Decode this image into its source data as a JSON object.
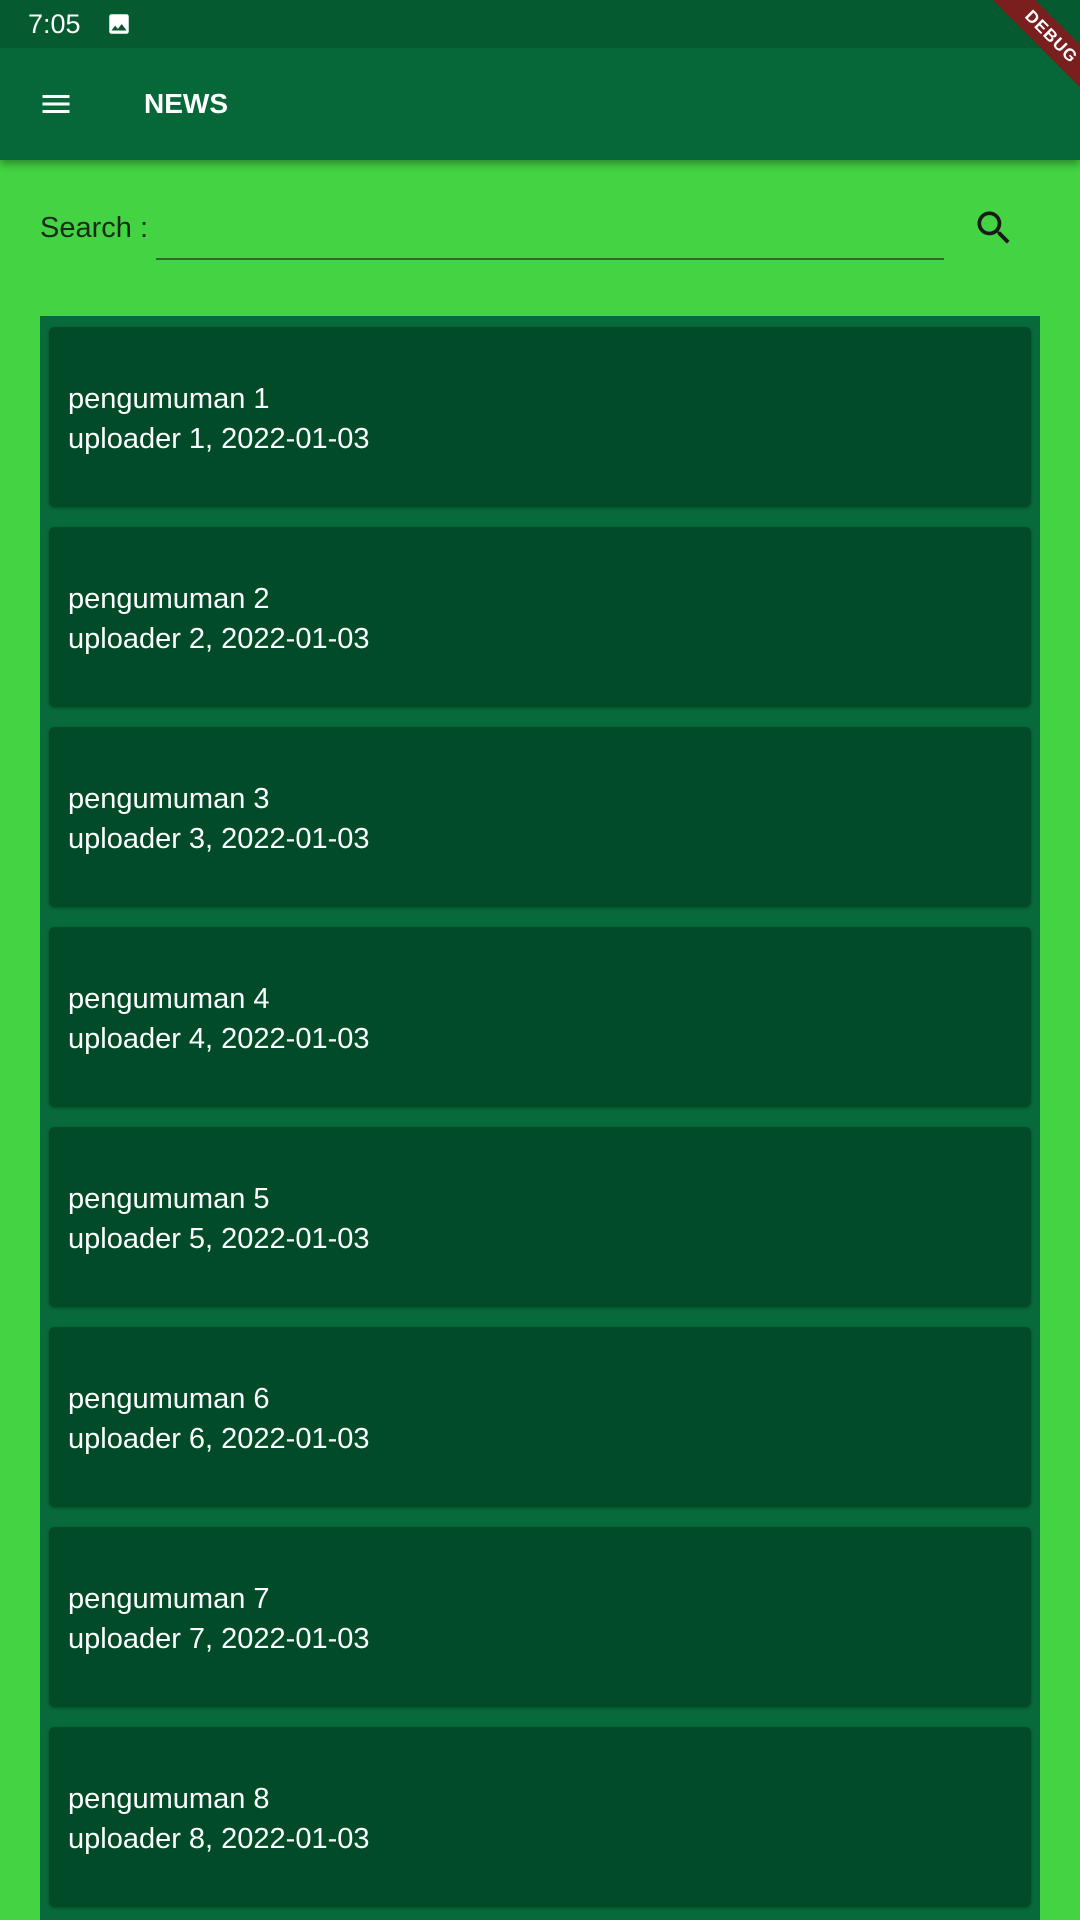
{
  "status_bar": {
    "time": "7:05",
    "notification_icon": "image-icon"
  },
  "app_bar": {
    "menu_icon": "menu-icon",
    "title": "NEWS"
  },
  "debug_banner": {
    "label": "DEBUG",
    "color": "#7a1e1e"
  },
  "search": {
    "label": "Search :",
    "value": "",
    "placeholder": "",
    "icon": "search-icon"
  },
  "news": [
    {
      "title": "pengumuman 1",
      "meta": "uploader 1, 2022-01-03"
    },
    {
      "title": "pengumuman 2",
      "meta": "uploader 2, 2022-01-03"
    },
    {
      "title": "pengumuman 3",
      "meta": "uploader 3, 2022-01-03"
    },
    {
      "title": "pengumuman 4",
      "meta": "uploader 4, 2022-01-03"
    },
    {
      "title": "pengumuman 5",
      "meta": "uploader 5, 2022-01-03"
    },
    {
      "title": "pengumuman 6",
      "meta": "uploader 6, 2022-01-03"
    },
    {
      "title": "pengumuman 7",
      "meta": "uploader 7, 2022-01-03"
    },
    {
      "title": "pengumuman 8",
      "meta": "uploader 8, 2022-01-03"
    }
  ],
  "colors": {
    "page_background": "#43d343",
    "app_bar": "#066838",
    "status_bar": "#055a30",
    "card": "#024b29",
    "list_background": "#086a3a"
  }
}
